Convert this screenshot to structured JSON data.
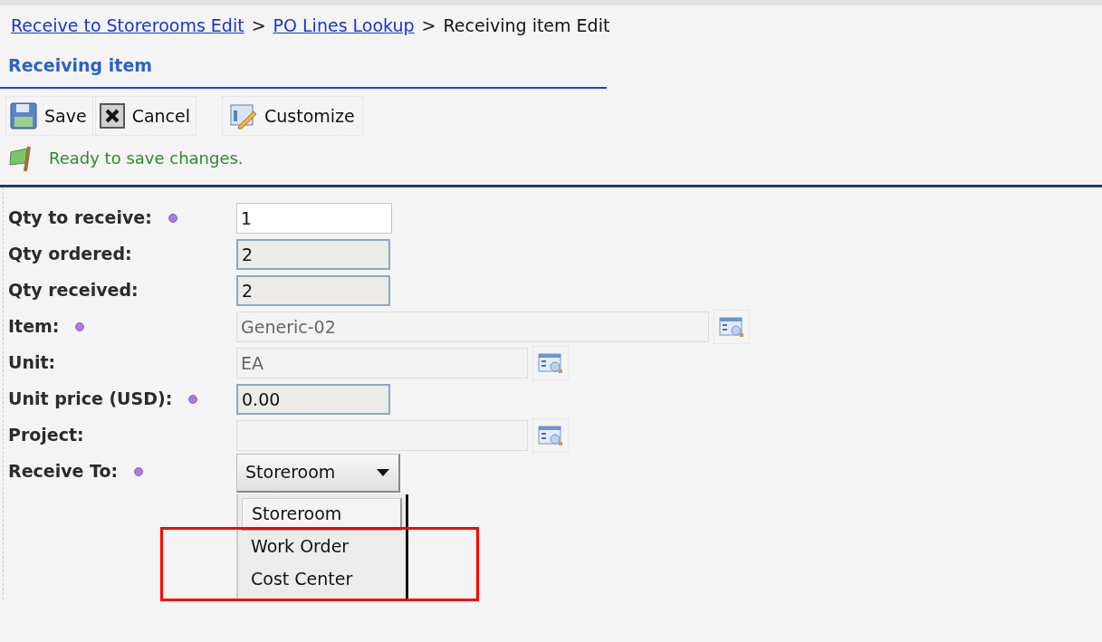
{
  "breadcrumbs": [
    {
      "label": "Receive to Storerooms Edit",
      "link": true
    },
    {
      "label": "PO Lines Lookup",
      "link": true
    },
    {
      "label": "Receiving item Edit",
      "link": false
    }
  ],
  "breadcrumb_separator": ">",
  "section_title": "Receiving item",
  "toolbar": [
    {
      "kind": "save",
      "label": "Save"
    },
    {
      "kind": "cancel",
      "label": "Cancel"
    },
    {
      "kind": "customize",
      "label": "Customize"
    }
  ],
  "status_message": "Ready to save changes.",
  "fields": [
    {
      "label": "Qty to receive:",
      "required": true,
      "kind": "input",
      "value": "1"
    },
    {
      "label": "Qty ordered:",
      "required": false,
      "kind": "readonly",
      "value": "2"
    },
    {
      "label": "Qty received:",
      "required": false,
      "kind": "readonly",
      "value": "2"
    },
    {
      "label": "Item:",
      "required": true,
      "kind": "long_lookup",
      "value": "Generic-02"
    },
    {
      "label": "Unit:",
      "required": false,
      "kind": "lookup",
      "value": "EA"
    },
    {
      "label": "Unit price (USD):",
      "required": true,
      "kind": "readonly",
      "value": "0.00"
    },
    {
      "label": "Project:",
      "required": false,
      "kind": "lookup"
    },
    {
      "label": "Receive To:",
      "required": true,
      "kind": "select",
      "value": "Storeroom",
      "open": true,
      "options": [
        {
          "label": "Storeroom",
          "selected": true,
          "highlighted": false
        },
        {
          "label": "Work Order",
          "selected": false,
          "highlighted": true
        },
        {
          "label": "Cost Center",
          "selected": false,
          "highlighted": true
        }
      ]
    }
  ]
}
